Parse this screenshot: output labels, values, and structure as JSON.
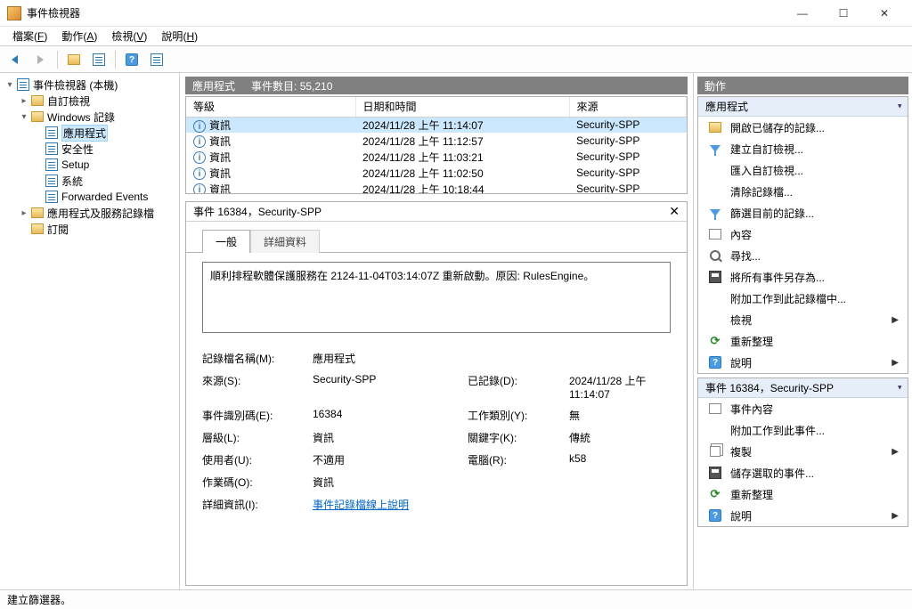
{
  "window": {
    "title": "事件檢視器"
  },
  "menubar": [
    {
      "label": "檔案",
      "key": "F"
    },
    {
      "label": "動作",
      "key": "A"
    },
    {
      "label": "檢視",
      "key": "V"
    },
    {
      "label": "說明",
      "key": "H"
    }
  ],
  "tree": {
    "root": "事件檢視器 (本機)",
    "custom": "自訂檢視",
    "windows_logs": "Windows 記錄",
    "windows_children": [
      {
        "label": "應用程式",
        "selected": true
      },
      {
        "label": "安全性"
      },
      {
        "label": "Setup"
      },
      {
        "label": "系統"
      },
      {
        "label": "Forwarded Events"
      }
    ],
    "app_services": "應用程式及服務記錄檔",
    "subscriptions": "訂閱"
  },
  "center": {
    "header_name": "應用程式",
    "header_count_label": "事件數目:",
    "header_count": "55,210",
    "columns": [
      "等級",
      "日期和時間",
      "來源"
    ],
    "rows": [
      {
        "level": "資訊",
        "date": "2024/11/28 上午 11:14:07",
        "source": "Security-SPP"
      },
      {
        "level": "資訊",
        "date": "2024/11/28 上午 11:12:57",
        "source": "Security-SPP"
      },
      {
        "level": "資訊",
        "date": "2024/11/28 上午 11:03:21",
        "source": "Security-SPP"
      },
      {
        "level": "資訊",
        "date": "2024/11/28 上午 11:02:50",
        "source": "Security-SPP"
      },
      {
        "level": "資訊",
        "date": "2024/11/28 上午 10:18:44",
        "source": "Security-SPP"
      }
    ]
  },
  "detail": {
    "title": "事件 16384，Security-SPP",
    "tab_general": "一般",
    "tab_details": "詳細資料",
    "message": "順利排程軟體保護服務在 2124-11-04T03:14:07Z 重新啟動。原因: RulesEngine。",
    "fields": {
      "log_name_lbl": "記錄檔名稱(M):",
      "log_name": "應用程式",
      "source_lbl": "來源(S):",
      "source": "Security-SPP",
      "logged_lbl": "已記錄(D):",
      "logged": "2024/11/28 上午 11:14:07",
      "event_id_lbl": "事件識別碼(E):",
      "event_id": "16384",
      "task_cat_lbl": "工作類別(Y):",
      "task_cat": "無",
      "level_lbl": "層級(L):",
      "level": "資訊",
      "keywords_lbl": "關鍵字(K):",
      "keywords": "傳統",
      "user_lbl": "使用者(U):",
      "user": "不適用",
      "computer_lbl": "電腦(R):",
      "computer": "k58",
      "opcode_lbl": "作業碼(O):",
      "opcode": "資訊",
      "more_info_lbl": "詳細資訊(I):",
      "more_info_link": "事件記錄檔線上說明"
    }
  },
  "actions": {
    "header": "動作",
    "group1_title": "應用程式",
    "group1": [
      {
        "icon": "folder",
        "label": "開啟已儲存的記錄..."
      },
      {
        "icon": "filter",
        "label": "建立自訂檢視..."
      },
      {
        "icon": "blank",
        "label": "匯入自訂檢視..."
      },
      {
        "icon": "blank",
        "label": "清除記錄檔..."
      },
      {
        "icon": "filter",
        "label": "篩選目前的記錄..."
      },
      {
        "icon": "props",
        "label": "內容"
      },
      {
        "icon": "find",
        "label": "尋找..."
      },
      {
        "icon": "save",
        "label": "將所有事件另存為..."
      },
      {
        "icon": "blank",
        "label": "附加工作到此記錄檔中..."
      },
      {
        "icon": "blank",
        "label": "檢視",
        "arrow": true
      },
      {
        "icon": "refresh",
        "label": "重新整理"
      },
      {
        "icon": "help",
        "label": "說明",
        "arrow": true
      }
    ],
    "group2_title": "事件 16384，Security-SPP",
    "group2": [
      {
        "icon": "props",
        "label": "事件內容"
      },
      {
        "icon": "blank",
        "label": "附加工作到此事件..."
      },
      {
        "icon": "copy",
        "label": "複製",
        "arrow": true
      },
      {
        "icon": "save",
        "label": "儲存選取的事件..."
      },
      {
        "icon": "refresh",
        "label": "重新整理"
      },
      {
        "icon": "help",
        "label": "說明",
        "arrow": true
      }
    ]
  },
  "statusbar": "建立篩選器。"
}
